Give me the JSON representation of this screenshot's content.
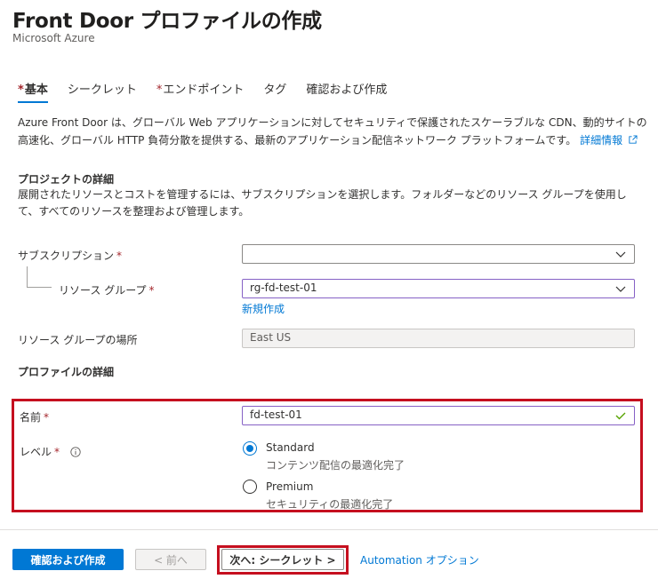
{
  "header": {
    "title": "Front Door プロファイルの作成",
    "more": "···",
    "subtitle": "Microsoft Azure"
  },
  "tabs": [
    {
      "label": "基本",
      "required": "*",
      "active": true
    },
    {
      "label": "シークレット",
      "required": "",
      "active": false
    },
    {
      "label": "エンドポイント",
      "required": "*",
      "active": false
    },
    {
      "label": "タグ",
      "required": "",
      "active": false
    },
    {
      "label": "確認および作成",
      "required": "",
      "active": false
    }
  ],
  "description": {
    "text": "Azure Front Door は、グローバル Web アプリケーションに対してセキュリティで保護されたスケーラブルな CDN、動的サイトの高速化、グローバル HTTP 負荷分散を提供する、最新のアプリケーション配信ネットワーク プラットフォームです。",
    "link": "詳細情報"
  },
  "project": {
    "title": "プロジェクトの詳細",
    "desc": "展開されたリソースとコストを管理するには、サブスクリプションを選択します。フォルダーなどのリソース グループを使用して、すべてのリソースを整理および管理します。",
    "subscription_label": "サブスクリプション",
    "subscription_value": "",
    "rg_label": "リソース グループ",
    "rg_value": "rg-fd-test-01",
    "create_new": "新規作成",
    "location_label": "リソース グループの場所",
    "location_value": "East US"
  },
  "profile": {
    "title": "プロファイルの詳細",
    "name_label": "名前",
    "name_value": "fd-test-01",
    "tier_label": "レベル",
    "options": [
      {
        "title": "Standard",
        "sub": "コンテンツ配信の最適化完了",
        "checked": true
      },
      {
        "title": "Premium",
        "sub": "セキュリティの最適化完了",
        "checked": false
      }
    ]
  },
  "required_mark": "*",
  "footer": {
    "review_create": "確認および作成",
    "prev": "< 前へ",
    "next": "次へ: シークレット >",
    "automation": "Automation オプション"
  },
  "colors": {
    "accent": "#0078d4",
    "highlight": "#c50f1f",
    "valid": "#57a300"
  }
}
